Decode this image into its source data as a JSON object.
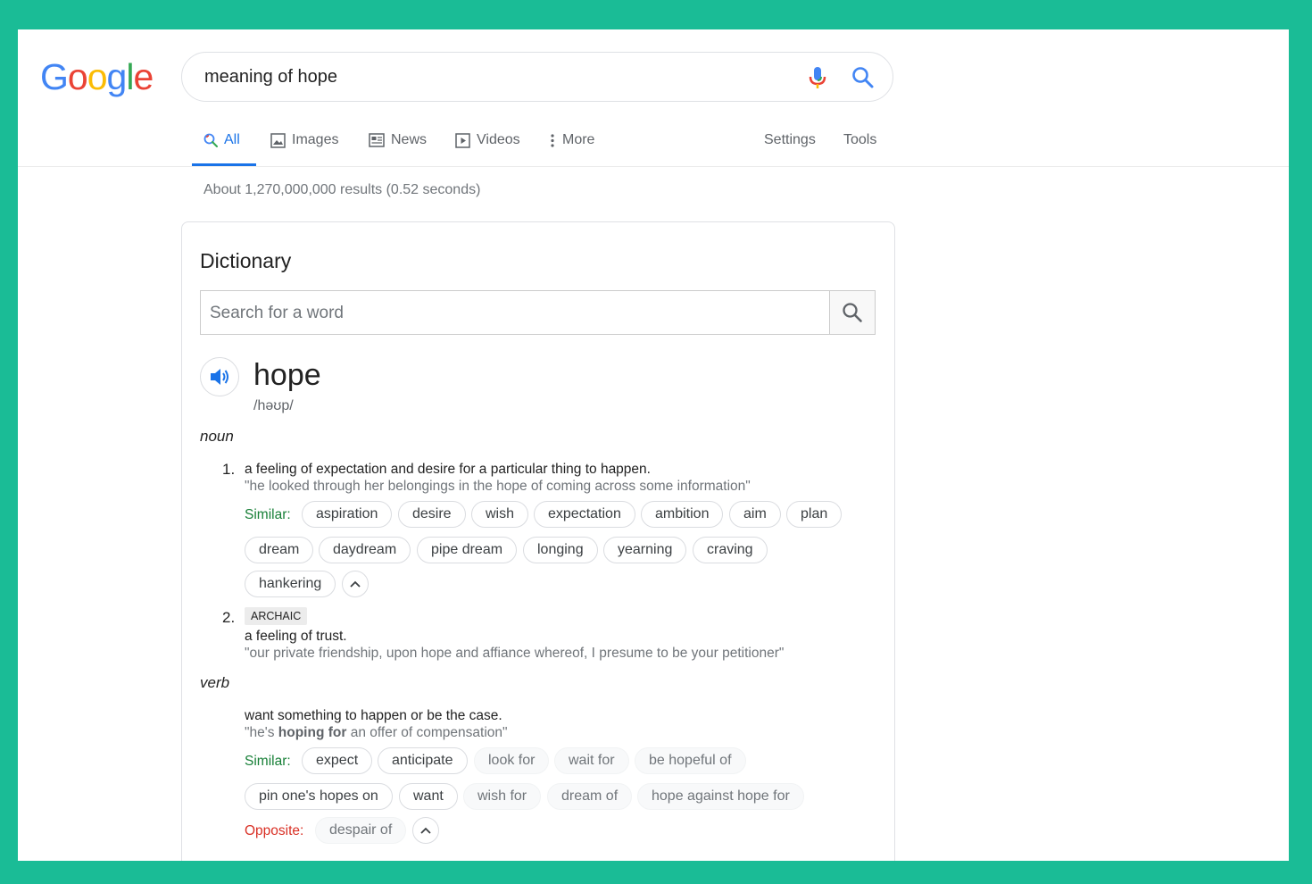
{
  "logo": {
    "letters": [
      {
        "ch": "G",
        "color": "#4285f4"
      },
      {
        "ch": "o",
        "color": "#ea4335"
      },
      {
        "ch": "o",
        "color": "#fbbc05"
      },
      {
        "ch": "g",
        "color": "#4285f4"
      },
      {
        "ch": "l",
        "color": "#34a853"
      },
      {
        "ch": "e",
        "color": "#ea4335"
      }
    ]
  },
  "search": {
    "query": "meaning of hope",
    "mic_icon": "microphone-icon",
    "search_icon": "search-icon"
  },
  "tabs": [
    {
      "label": "All",
      "icon": "search-icon",
      "active": true
    },
    {
      "label": "Images",
      "icon": "image-icon"
    },
    {
      "label": "News",
      "icon": "news-icon"
    },
    {
      "label": "Videos",
      "icon": "play-icon"
    },
    {
      "label": "More",
      "icon": "more-vert-icon"
    }
  ],
  "tools": {
    "settings": "Settings",
    "tools": "Tools"
  },
  "results_stats": "About 1,270,000,000 results (0.52 seconds)",
  "dictionary": {
    "title": "Dictionary",
    "word_search_placeholder": "Search for a word",
    "headword": "hope",
    "phonetic": "/həʊp/",
    "noun": {
      "pos": "noun",
      "senses": [
        {
          "number": "1.",
          "definition": "a feeling of expectation and desire for a particular thing to happen.",
          "example": "\"he looked through her belongings in the hope of coming across some information\"",
          "similar_label": "Similar:",
          "similar": [
            "aspiration",
            "desire",
            "wish",
            "expectation",
            "ambition",
            "aim",
            "plan",
            "dream",
            "daydream",
            "pipe dream",
            "longing",
            "yearning",
            "craving",
            "hankering"
          ]
        },
        {
          "number": "2.",
          "label": "ARCHAIC",
          "definition": "a feeling of trust.",
          "example": "\"our private friendship, upon hope and affiance whereof, I presume to be your petitioner\""
        }
      ]
    },
    "verb": {
      "pos": "verb",
      "definition": "want something to happen or be the case.",
      "example_pre": "\"he's ",
      "example_bold": "hoping for",
      "example_post": " an offer of compensation\"",
      "similar_label": "Similar:",
      "similar": [
        "expect",
        "anticipate",
        "look for",
        "wait for",
        "be hopeful of",
        "pin one's hopes on",
        "want",
        "wish for",
        "dream of",
        "hope against hope for"
      ],
      "opposite_label": "Opposite:",
      "opposite": [
        "despair of"
      ]
    }
  },
  "colors": {
    "accent": "#1a73e8",
    "similar": "#188038",
    "opposite": "#d93025",
    "frame": "#1abc96"
  }
}
